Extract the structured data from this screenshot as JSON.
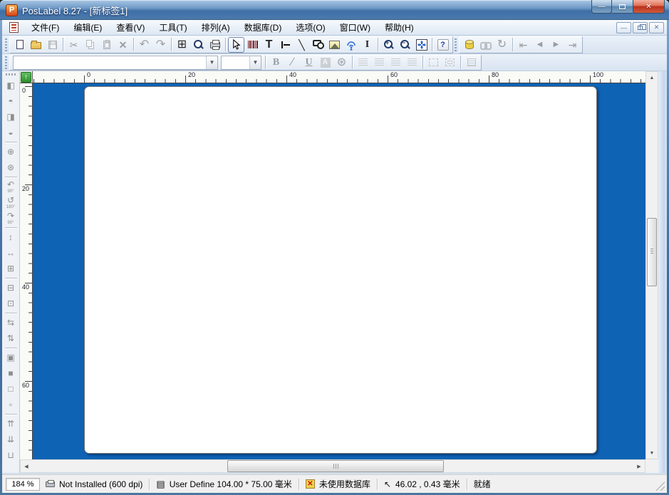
{
  "titlebar": {
    "title": "PosLabel 8.27 - [新标签1]"
  },
  "menubar": {
    "items": [
      "文件(F)",
      "编辑(E)",
      "查看(V)",
      "工具(T)",
      "排列(A)",
      "数据库(D)",
      "选项(O)",
      "窗口(W)",
      "帮助(H)"
    ]
  },
  "format_bar": {
    "font_value": "",
    "size_value": ""
  },
  "icons": {
    "app": "P",
    "min": "—",
    "close": "✕",
    "mdi_min": "—",
    "mdi_close": "✕",
    "scissors": "✂",
    "delete": "✕",
    "undo": "↶",
    "redo": "↷",
    "page_setup": "⊞",
    "text": "T",
    "diagonal_line": "╲",
    "ibeam": "I",
    "zoom_plus": "+",
    "zoom_minus": "−",
    "help": "?",
    "refresh": "↻",
    "nav_first": "⇤",
    "nav_prev": "◀",
    "nav_next": "▶",
    "nav_last": "⇥",
    "bold": "B",
    "italic": "∕",
    "underline": "U",
    "font_color": "A",
    "texture": "⊛",
    "ruler_origin": "↑",
    "doc": "▤",
    "db_cross": "✕",
    "cursor": "↖",
    "scroll_up": "▲",
    "scroll_down": "▼",
    "scroll_left": "◀",
    "scroll_right": "▶"
  },
  "left_toolbar": [
    {
      "name": "align-left",
      "glyph": "◧"
    },
    {
      "name": "align-top",
      "glyph": "◓"
    },
    {
      "name": "align-right",
      "glyph": "◨"
    },
    {
      "name": "align-bottom",
      "glyph": "◒"
    },
    {
      "name": "center-horizontal",
      "glyph": "⊕"
    },
    {
      "name": "center-both",
      "glyph": "⊛"
    },
    {
      "name": "rotate-90",
      "glyph": "↶",
      "sub": "90°"
    },
    {
      "name": "rotate-180",
      "glyph": "↺",
      "sub": "180°"
    },
    {
      "name": "rotate-270",
      "glyph": "↷",
      "sub": "90°"
    },
    {
      "name": "same-height",
      "glyph": "↕"
    },
    {
      "name": "same-width",
      "glyph": "↔"
    },
    {
      "name": "same-size",
      "glyph": "⊞"
    },
    {
      "name": "center-h-in-label",
      "glyph": "⊟"
    },
    {
      "name": "center-v-in-label",
      "glyph": "⊡"
    },
    {
      "name": "equal-h-spacing",
      "glyph": "⇆"
    },
    {
      "name": "equal-v-spacing",
      "glyph": "⇅"
    },
    {
      "name": "bring-forward",
      "glyph": "▣"
    },
    {
      "name": "bring-to-front",
      "glyph": "■"
    },
    {
      "name": "send-to-back",
      "glyph": "□"
    },
    {
      "name": "send-backward",
      "glyph": "▫"
    },
    {
      "name": "fit-label-width",
      "glyph": "⇈"
    },
    {
      "name": "fit-label-height",
      "glyph": "⇊"
    },
    {
      "name": "fit-label-size",
      "glyph": "⊔"
    }
  ],
  "ruler": {
    "h": [
      "0",
      "20",
      "40",
      "60",
      "80",
      "100"
    ],
    "v": [
      "0",
      "20",
      "40",
      "60"
    ]
  },
  "statusbar": {
    "zoom": "184 %",
    "printer_status": "Not Installed (600 dpi)",
    "stock": "User Define  104.00 * 75.00 毫米",
    "database_status": "未使用数据库",
    "position": "46.02 , 0.43 毫米",
    "state": "就绪"
  },
  "colors": {
    "canvas_bg": "#0e63b5",
    "label_bg": "#ffffff",
    "title_glass": "#4f7fb0",
    "close_red": "#c4392b"
  }
}
